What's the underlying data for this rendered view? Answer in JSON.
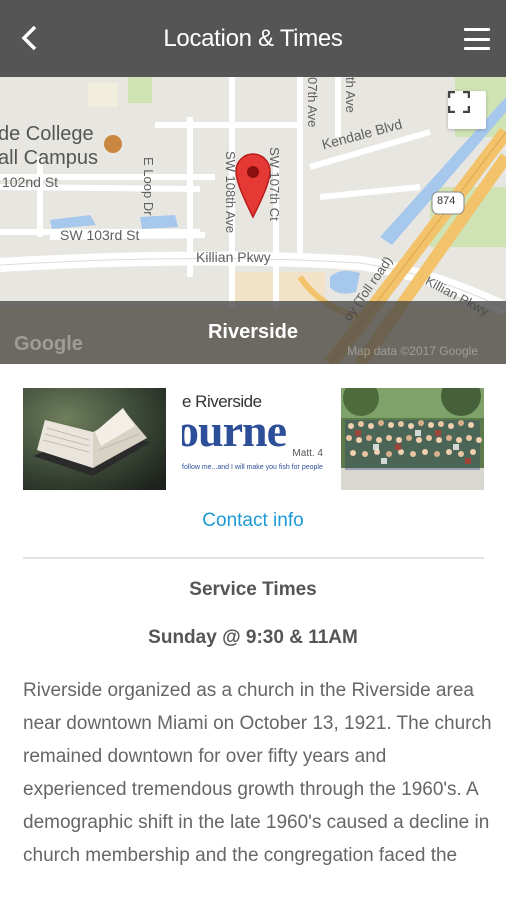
{
  "header": {
    "title": "Location & Times",
    "back_icon": "chevron-left-icon",
    "menu_icon": "hamburger-menu-icon"
  },
  "map": {
    "labels": {
      "college": "de College",
      "campus": "all Campus",
      "st102": "102nd St",
      "st103": "SW 103rd St",
      "eloop": "E Loop Dr",
      "ave108": "SW 108th Ave",
      "ct107": "SW 107th Ct",
      "ave107": "07th Ave",
      "ave_top": "th Ave",
      "kendale": "Kendale Blvd",
      "killian": "Killian Pkwy",
      "killian2": "Killian Pkwy",
      "tollroad": "oy (Toll road)",
      "route": "874"
    },
    "location_name": "Riverside",
    "google_logo": "Google",
    "map_data": "Map data ©2017 Google",
    "fullscreen_icon": "fullscreen-icon"
  },
  "gallery": {
    "journey": {
      "top": "e Riverside",
      "big": "ourne",
      "ref": "Matt. 4",
      "tagline": "follow me...and I will make you fish for people"
    }
  },
  "contact_link": "Contact info",
  "service": {
    "heading": "Service Times",
    "time": "Sunday @ 9:30 & 11AM"
  },
  "description": "Riverside organized as a church in the Riverside area near downtown Miami on October 13, 1921. The church remained downtown for over fifty years and experienced tremendous growth through the 1960's. A demographic shift in the late 1960's caused a decline in church membership and the congregation faced the",
  "colors": {
    "header_bg": "#555555",
    "link": "#1d9ad6",
    "pin": "#e53935",
    "toll_road": "#f2c36b"
  }
}
